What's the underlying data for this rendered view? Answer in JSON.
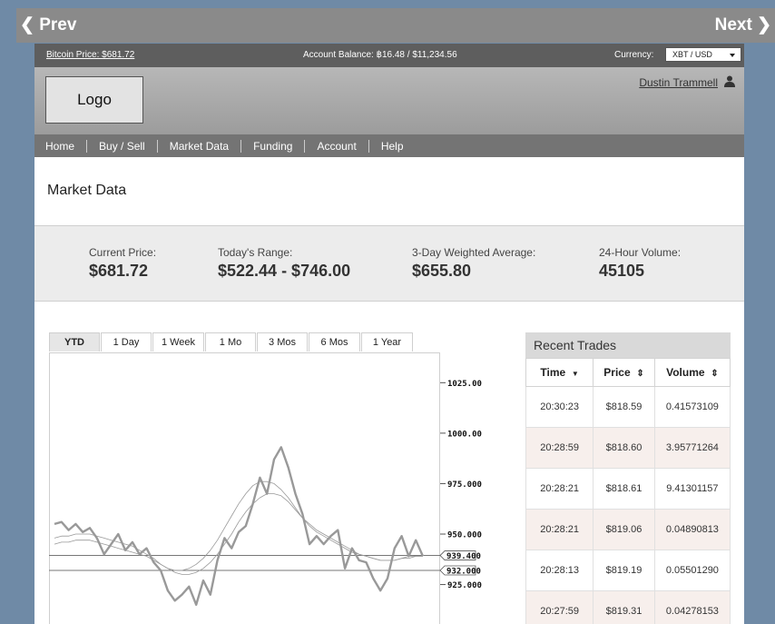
{
  "nav_top": {
    "prev": "Prev",
    "next": "Next"
  },
  "infobar": {
    "bitcoin_price": "Bitcoin Price: $681.72",
    "balance": "Account Balance: ฿16.48 / $11,234.56",
    "currency_label": "Currency:",
    "currency_value": "XBT / USD"
  },
  "header": {
    "logo": "Logo",
    "user": "Dustin Trammell"
  },
  "menu": [
    "Home",
    "Buy / Sell",
    "Market Data",
    "Funding",
    "Account",
    "Help"
  ],
  "page_title": "Market Data",
  "stats": [
    {
      "label": "Current Price:",
      "value": "$681.72"
    },
    {
      "label": "Today's Range:",
      "value": "$522.44 - $746.00"
    },
    {
      "label": "3-Day Weighted Average:",
      "value": "$655.80"
    },
    {
      "label": "24-Hour Volume:",
      "value": "45105"
    }
  ],
  "tabs": [
    "YTD",
    "1 Day",
    "1 Week",
    "1 Mo",
    "3 Mos",
    "6 Mos",
    "1 Year"
  ],
  "active_tab": "YTD",
  "colors": {
    "price_line": "#999999",
    "avg_line": "#999999",
    "nav_bg": "#747474"
  },
  "chart_data": {
    "type": "line",
    "y_ticks": [
      1025.0,
      1000.0,
      975.0,
      950.0,
      925.0
    ],
    "y_tick_labels": [
      "1025.00",
      "1000.00",
      "975.000",
      "950.000",
      "925.000"
    ],
    "ylim": [
      905,
      1040
    ],
    "reference_lines": [
      {
        "value": 939.4,
        "label": "939.400"
      },
      {
        "value": 932.0,
        "label": "932.000"
      }
    ],
    "series": [
      {
        "values": [
          955,
          956,
          952,
          955,
          951,
          953,
          948,
          940,
          945,
          950,
          942,
          946,
          940,
          943,
          936,
          932,
          922,
          917,
          920,
          924,
          915,
          927,
          920,
          937,
          948,
          943,
          951,
          954,
          965,
          978,
          970,
          987,
          993,
          983,
          970,
          960,
          945,
          949,
          945,
          949,
          952,
          933,
          943,
          937,
          936,
          928,
          922,
          928,
          943,
          949,
          939,
          947,
          939
        ]
      },
      {
        "values": [
          945,
          946,
          946,
          947,
          947,
          947,
          946,
          945,
          944,
          943,
          942,
          941,
          940,
          939,
          937,
          935,
          933,
          932,
          932,
          933,
          935,
          938,
          942,
          947,
          953,
          959,
          965,
          970,
          974,
          976,
          976,
          975,
          972,
          968,
          963,
          958,
          954,
          951,
          949,
          947,
          945,
          943,
          941,
          940,
          939,
          938,
          937,
          937,
          937,
          938,
          939,
          939,
          939
        ]
      },
      {
        "values": [
          948,
          949,
          949,
          950,
          950,
          950,
          949,
          948,
          947,
          946,
          945,
          944,
          942,
          940,
          938,
          935,
          933,
          931,
          930,
          930,
          931,
          933,
          936,
          940,
          945,
          950,
          956,
          961,
          965,
          968,
          970,
          970,
          969,
          966,
          962,
          958,
          955,
          952,
          950,
          948,
          946,
          944,
          942,
          940,
          939,
          938,
          937,
          937,
          937,
          938,
          938,
          939,
          939
        ]
      }
    ]
  },
  "trades": {
    "title": "Recent Trades",
    "columns": [
      "Time",
      "Price",
      "Volume"
    ],
    "rows": [
      [
        "20:30:23",
        "$818.59",
        "0.41573109"
      ],
      [
        "20:28:59",
        "$818.60",
        "3.95771264"
      ],
      [
        "20:28:21",
        "$818.61",
        "9.41301157"
      ],
      [
        "20:28:21",
        "$819.06",
        "0.04890813"
      ],
      [
        "20:28:13",
        "$819.19",
        "0.05501290"
      ],
      [
        "20:27:59",
        "$819.31",
        "0.04278153"
      ]
    ]
  }
}
